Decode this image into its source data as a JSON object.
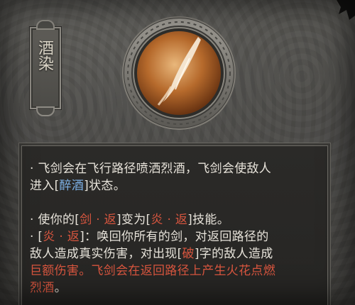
{
  "skill": {
    "name": "酒染",
    "colors": {
      "highlight_red": "#d9563f",
      "highlight_blue": "#7db1e6",
      "text": "#e7e3da",
      "icon_orange": "#b66a2c"
    },
    "icon": "flying-sword-icon"
  },
  "description": {
    "line1_a": "· 飞剑会在飞行路径喷洒烈酒，飞剑会使敌人",
    "line2_a": "进入[",
    "line2_term": "醉酒",
    "line2_b": "]状态。",
    "line3_a": "· 使你的[",
    "line3_term1": "剑 · 返",
    "line3_b": "]变为[",
    "line3_term2": "炎 · 返",
    "line3_c": "]技能。",
    "line4_a": "· [",
    "line4_term": "炎 · 返",
    "line4_b": "]：唤回你所有的剑，对返回路径的",
    "line5": "敌人造成真实伤害，对出现[",
    "line5_term": "破",
    "line5_b": "]字的敌人造成",
    "line6_red": "巨额伤害",
    "line6_b": "。飞剑会在返回路径上产生火花点燃",
    "line7_red": "烈酒",
    "line7_b": "。"
  }
}
